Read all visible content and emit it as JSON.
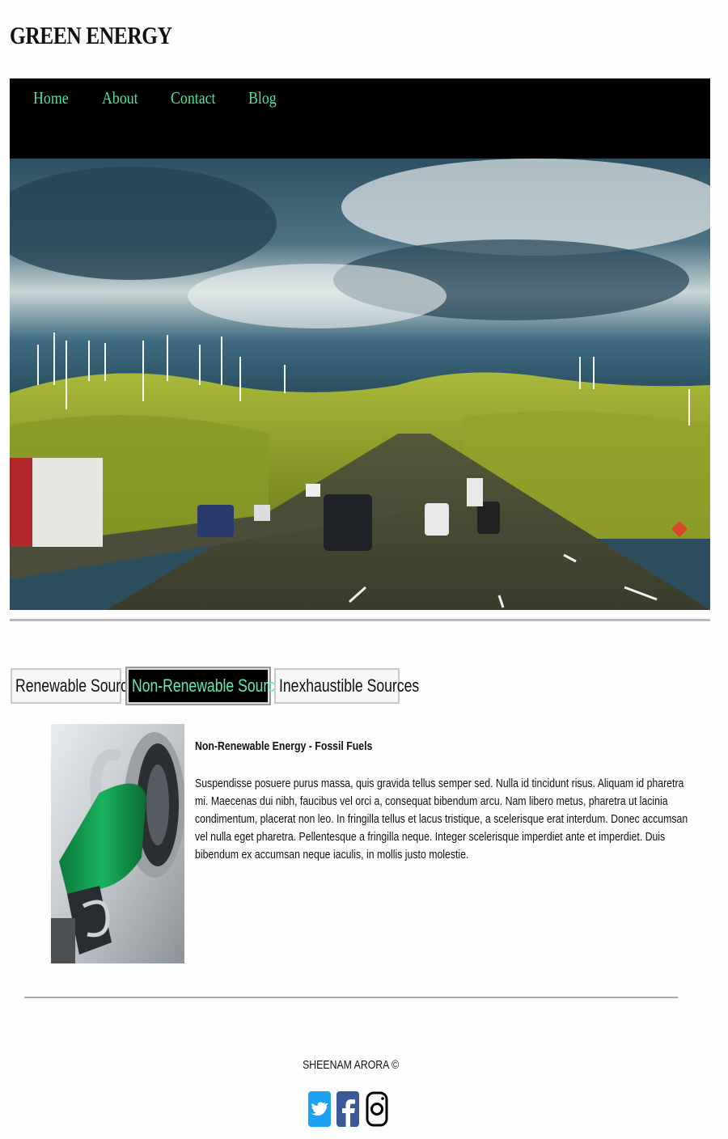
{
  "site": {
    "title": "GREEN ENERGY"
  },
  "nav": {
    "items": [
      {
        "label": "Home"
      },
      {
        "label": "About"
      },
      {
        "label": "Contact"
      },
      {
        "label": "Blog"
      }
    ],
    "link_color": "#4be3a0",
    "background": "#000000"
  },
  "hero": {
    "icon": "highway-wind-turbines-photo"
  },
  "tabs": {
    "items": [
      {
        "label": "Renewable Sources",
        "active": false
      },
      {
        "label": "Non-Renewable Sources",
        "active": true
      },
      {
        "label": "Inexhaustible Sources",
        "active": false
      }
    ]
  },
  "content": {
    "image_icon": "fuel-pump-nozzle-photo",
    "heading": "Non-Renewable Energy - Fossil Fuels",
    "body": "Suspendisse posuere purus massa, quis gravida tellus semper sed. Nulla id tincidunt risus. Aliquam id pharetra mi. Maecenas dui nibh, faucibus vel orci a, consequat bibendum arcu. Nam libero metus, pharetra ut lacinia condimentum, placerat non leo. In fringilla tellus et lacus tristique, a scelerisque erat interdum. Donec accumsan vel nulla eget pharetra. Pellentesque a fringilla neque. Integer scelerisque imperdiet ante et imperdiet. Duis bibendum ex accumsan neque iaculis, in mollis justo molestie."
  },
  "footer": {
    "credit": "SHEENAM ARORA ©",
    "social": [
      {
        "icon": "twitter-icon",
        "color": "#1da1f2"
      },
      {
        "icon": "facebook-icon",
        "color": "#3b5998"
      },
      {
        "icon": "instagram-icon",
        "color": "#000000"
      }
    ]
  }
}
